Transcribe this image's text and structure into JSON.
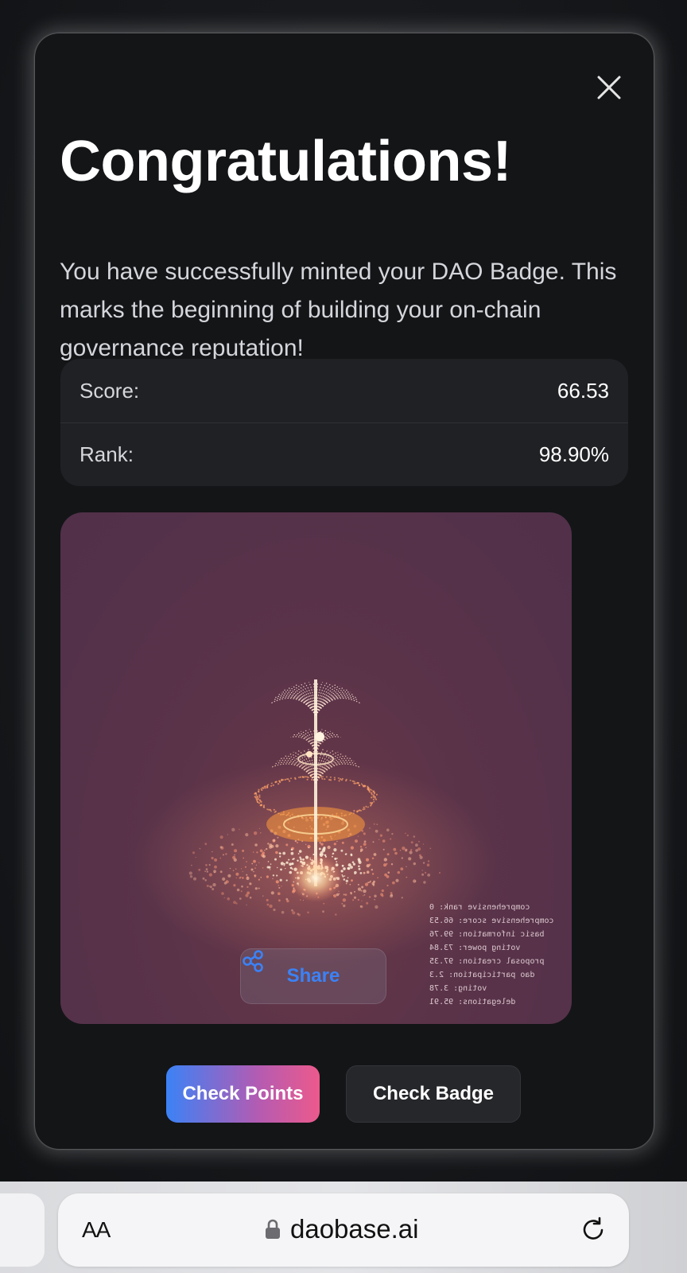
{
  "modal": {
    "title": "Congratulations!",
    "description": "You have successfully minted your DAO Badge. This marks the beginning of building your on-chain governance reputation!",
    "stats": [
      {
        "label": "Score:",
        "value": "66.53"
      },
      {
        "label": "Rank:",
        "value": "98.90%"
      }
    ],
    "close_icon": "close-icon"
  },
  "badge": {
    "overlay_stats": [
      "comprehensive rank: 0",
      "comprehensive score: 66.53",
      "basic information: 99.76",
      "voting power: 73.84",
      "proposal creation: 97.35",
      "dao participation: 2.3",
      "voting: 3.78",
      "delegations: 95.91"
    ],
    "share_label": "Share",
    "share_icon": "share-icon"
  },
  "actions": {
    "check_points_label": "Check Points",
    "check_badge_label": "Check Badge"
  },
  "browser": {
    "text_size_label": "AA",
    "url": "daobase.ai",
    "lock_icon": "lock-icon",
    "reload_icon": "reload-icon"
  },
  "colors": {
    "accent_blue": "#3b82f6",
    "accent_pink": "#ec5a8c",
    "modal_bg": "#141517",
    "card_bg": "#202124",
    "badge_bg": "#5a3349"
  }
}
